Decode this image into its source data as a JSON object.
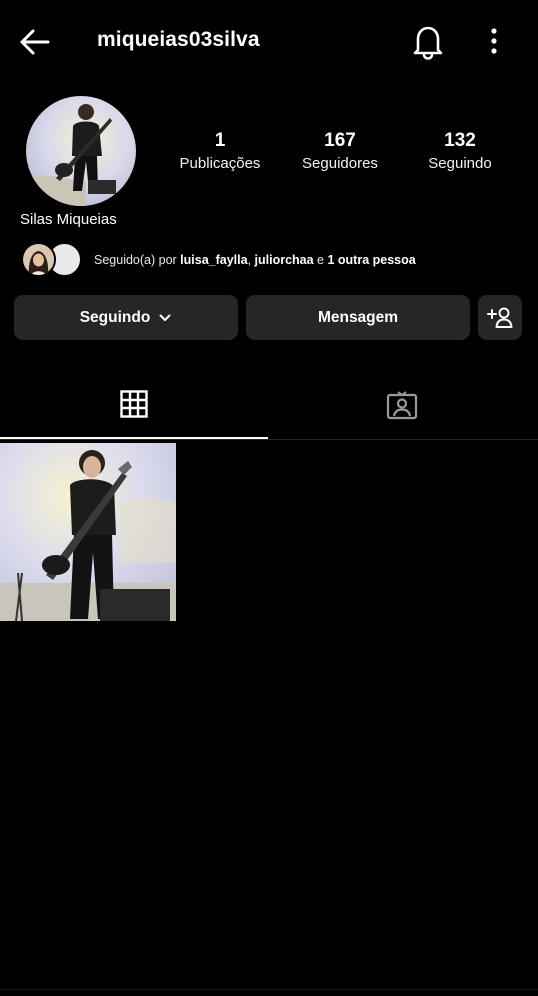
{
  "header": {
    "username": "miqueias03silva",
    "back_icon": "arrow-left-icon",
    "notifications_icon": "bell-icon",
    "more_icon": "more-vertical-icon"
  },
  "profile": {
    "full_name": "Silas Miqueias",
    "stats": [
      {
        "value": "1",
        "label": "Publicações"
      },
      {
        "value": "167",
        "label": "Seguidores"
      },
      {
        "value": "132",
        "label": "Seguindo"
      }
    ]
  },
  "followed_by": {
    "prefix": "Seguido(a) por ",
    "user1": "luisa_faylla",
    "sep": ", ",
    "user2": "juliorchaa",
    "mid": " e ",
    "others": "1 outra pessoa"
  },
  "actions": {
    "following_label": "Seguindo",
    "message_label": "Mensagem",
    "add_person_icon": "add-person-icon"
  },
  "tabs": [
    {
      "icon": "grid-icon",
      "active": true
    },
    {
      "icon": "tagged-person-icon",
      "active": false
    }
  ],
  "colors": {
    "background": "#000000",
    "button_bg": "#262626",
    "text": "#ffffff"
  }
}
